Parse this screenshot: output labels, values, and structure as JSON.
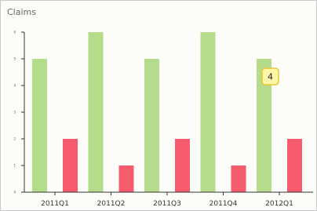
{
  "panel": {
    "title": "Claims"
  },
  "chart_data": {
    "type": "bar",
    "categories": [
      "2011Q1",
      "2011Q2",
      "2011Q3",
      "2011Q4",
      "2012Q1"
    ],
    "series": [
      {
        "values": [
          5,
          6,
          5,
          6,
          5
        ],
        "color": "#b5dc8b"
      },
      {
        "values": [
          2,
          1,
          2,
          1,
          2
        ],
        "color": "#f55b6d"
      }
    ],
    "ylim": [
      0,
      6
    ],
    "yticks": [
      "0",
      "1",
      "2",
      "3",
      "4",
      "5",
      "6"
    ],
    "grid": false,
    "tooltip": {
      "value": "4",
      "category": "2012Q1",
      "series_index": 0
    }
  }
}
